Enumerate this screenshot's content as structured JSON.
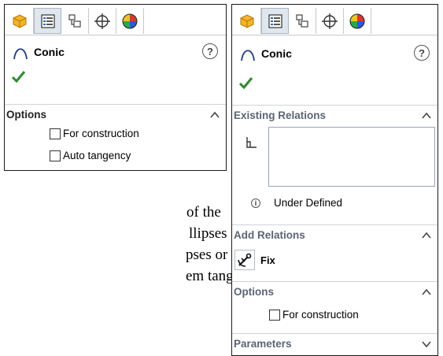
{
  "left_panel": {
    "title": "Conic",
    "help": "?",
    "options_label": "Options",
    "checkboxes": [
      "For construction",
      "Auto tangency"
    ]
  },
  "right_panel": {
    "title": "Conic",
    "help": "?",
    "existing_relations_label": "Existing Relations",
    "status_text": "Under Defined",
    "add_relations_label": "Add Relations",
    "fix_label": "Fix",
    "options_label": "Options",
    "checkbox": "For construction",
    "parameters_label": "Parameters"
  },
  "background_text": {
    "lines": [
      "of the",
      "llipses and",
      "pses or parabolas by",
      "em tangent to"
    ]
  },
  "colors": {
    "accent_check": "#2e8b2e",
    "section_grey": "#5b6573",
    "active_tab": "#dfe6ee"
  }
}
